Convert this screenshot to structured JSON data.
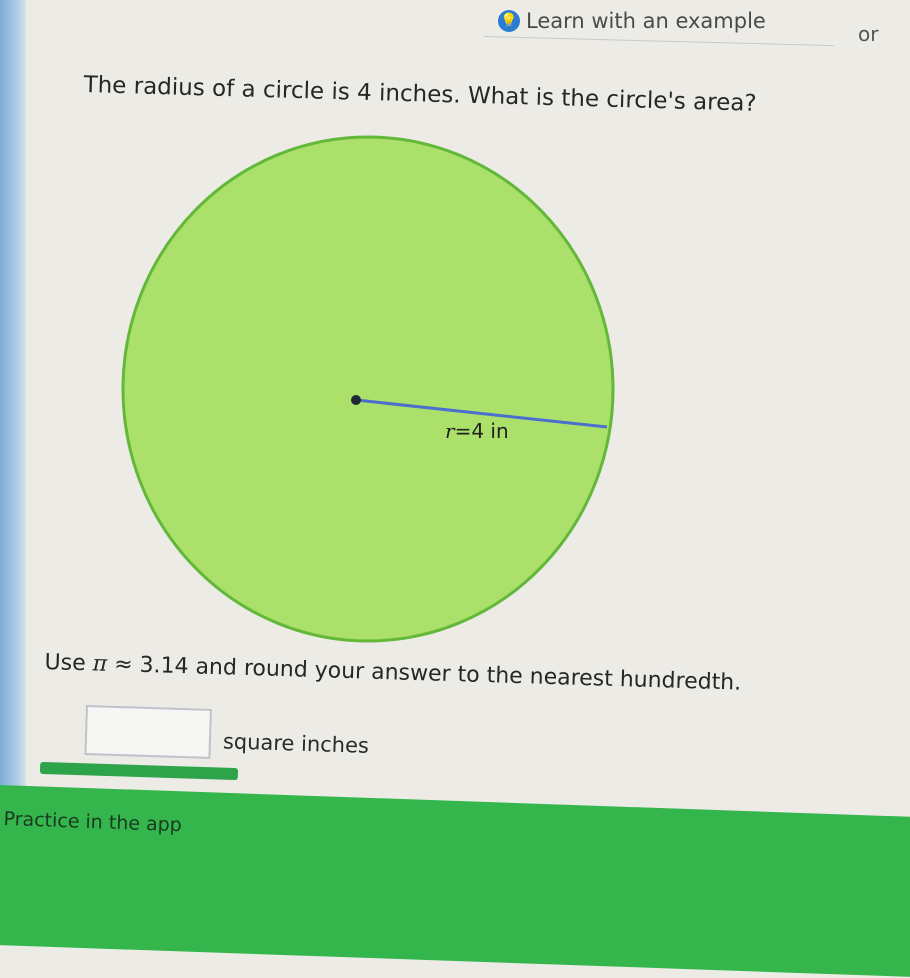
{
  "header": {
    "learn_link": "Learn with an example",
    "or_text": "or"
  },
  "problem": {
    "question": "The radius of a circle is 4 inches. What is the circle's area?",
    "radius_label_var": "r",
    "radius_label_eq": "=",
    "radius_label_value": "4 in",
    "instruction_prefix": "Use ",
    "instruction_pi": "π",
    "instruction_approx": " ≈ 3.14",
    "instruction_suffix": " and round your answer to the nearest hundredth."
  },
  "answer": {
    "value": "",
    "unit": "square inches"
  },
  "footer": {
    "practice_label": "Practice in the app"
  },
  "colors": {
    "circle_fill": "#abe06b",
    "circle_stroke": "#63b83a",
    "radius_line": "#4a6fcf",
    "practice_green": "#34b64d"
  }
}
